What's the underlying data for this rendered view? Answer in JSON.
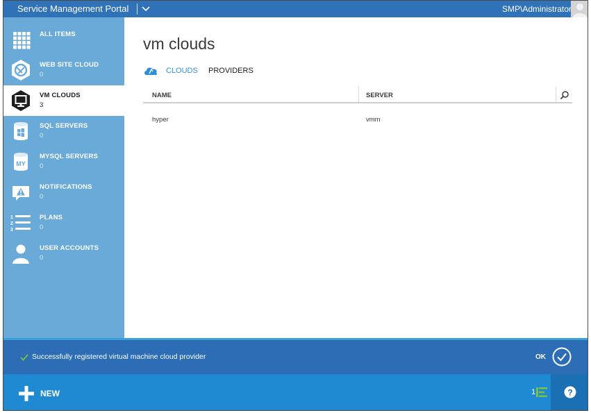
{
  "header": {
    "portal_title": "Service Management Portal",
    "user": "SMP\\Administrator",
    "avatar_icon": "user-avatar-icon",
    "menu_icon": "chevron-down-icon"
  },
  "sidebar": {
    "items": [
      {
        "label": "ALL ITEMS",
        "count": "",
        "icon": "grid-icon",
        "active": false
      },
      {
        "label": "WEB SITE CLOUD",
        "count": "0",
        "icon": "web-site-icon",
        "active": false
      },
      {
        "label": "VM CLOUDS",
        "count": "3",
        "icon": "monitor-icon",
        "active": true
      },
      {
        "label": "SQL SERVERS",
        "count": "0",
        "icon": "sql-database-icon",
        "active": false
      },
      {
        "label": "MYSQL SERVERS",
        "count": "0",
        "icon": "mysql-database-icon",
        "active": false
      },
      {
        "label": "NOTIFICATIONS",
        "count": "0",
        "icon": "alert-icon",
        "active": false
      },
      {
        "label": "PLANS",
        "count": "0",
        "icon": "numbered-list-icon",
        "active": false
      },
      {
        "label": "USER ACCOUNTS",
        "count": "0",
        "icon": "user-icon",
        "active": false
      }
    ]
  },
  "main": {
    "title": "vm clouds",
    "tabs": [
      {
        "label": "CLOUDS",
        "active": true
      },
      {
        "label": "PROVIDERS",
        "active": false
      }
    ],
    "table": {
      "columns": [
        "NAME",
        "SERVER"
      ],
      "rows": [
        {
          "name": "hyper",
          "server": "vmm"
        }
      ]
    }
  },
  "notification": {
    "message": "Successfully registered virtual machine cloud provider",
    "ok_label": "OK"
  },
  "footer": {
    "new_label": "NEW",
    "task_count": "1"
  },
  "colors": {
    "topbar": "#2f72b8",
    "sidebar": "#6aaad9",
    "accent": "#2f8fd6",
    "notification": "#2d6db5",
    "bottombar": "#1f8ad2",
    "success": "#7bc143"
  }
}
